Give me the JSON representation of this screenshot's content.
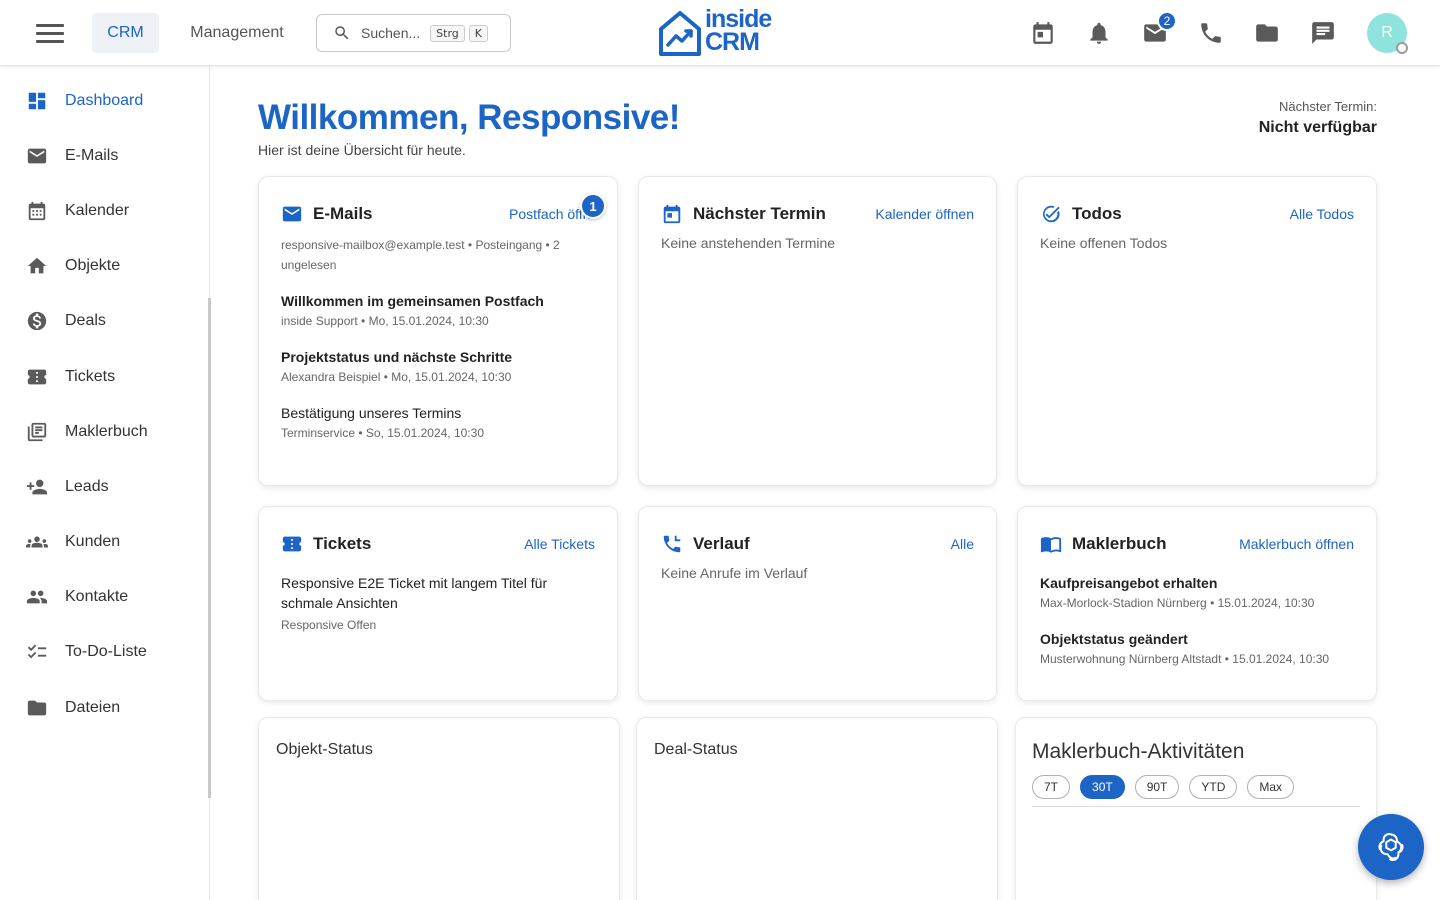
{
  "topbar": {
    "tabs": [
      "CRM",
      "Management"
    ],
    "search_placeholder": "Suchen...",
    "shortcut_keys": [
      "Strg",
      "K"
    ],
    "logo_line1": "inside",
    "logo_line2": "CRM",
    "mail_badge": "2",
    "avatar_initial": "R"
  },
  "sidebar": {
    "items": [
      {
        "label": "Dashboard",
        "icon": "dashboard-icon",
        "active": true
      },
      {
        "label": "E-Mails",
        "icon": "mail-icon"
      },
      {
        "label": "Kalender",
        "icon": "calendar-icon"
      },
      {
        "label": "Objekte",
        "icon": "home-icon"
      },
      {
        "label": "Deals",
        "icon": "dollar-icon"
      },
      {
        "label": "Tickets",
        "icon": "ticket-icon"
      },
      {
        "label": "Maklerbuch",
        "icon": "library-icon"
      },
      {
        "label": "Leads",
        "icon": "person-add-icon"
      },
      {
        "label": "Kunden",
        "icon": "groups-icon"
      },
      {
        "label": "Kontakte",
        "icon": "people-icon"
      },
      {
        "label": "To-Do-Liste",
        "icon": "checklist-icon"
      },
      {
        "label": "Dateien",
        "icon": "folder-icon"
      }
    ]
  },
  "header": {
    "welcome": "Willkommen, Responsive!",
    "subtitle": "Hier ist deine Übersicht für heute.",
    "next_label": "Nächster Termin:",
    "next_value": "Nicht verfügbar"
  },
  "cards": {
    "emails": {
      "title": "E-Mails",
      "link": "Postfach öffnen",
      "badge": "1",
      "summary": "responsive-mailbox@example.test • Posteingang • 2 ungelesen",
      "items": [
        {
          "subject": "Willkommen im gemeinsamen Postfach",
          "meta": "inside Support • Mo, 15.01.2024, 10:30"
        },
        {
          "subject": "Projektstatus und nächste Schritte",
          "meta": "Alexandra Beispiel • Mo, 15.01.2024, 10:30"
        },
        {
          "subject": "Bestätigung unseres Termins",
          "meta": "Terminservice • So, 15.01.2024, 10:30"
        }
      ]
    },
    "termin": {
      "title": "Nächster Termin",
      "link": "Kalender öffnen",
      "empty": "Keine anstehenden Termine"
    },
    "todos": {
      "title": "Todos",
      "link": "Alle Todos",
      "empty": "Keine offenen Todos"
    },
    "tickets": {
      "title": "Tickets",
      "link": "Alle Tickets",
      "items": [
        {
          "subject": "Responsive E2E Ticket mit langem Titel für schmale Ansichten",
          "meta": "Responsive Offen"
        }
      ]
    },
    "verlauf": {
      "title": "Verlauf",
      "link": "Alle",
      "empty": "Keine Anrufe im Verlauf"
    },
    "maklerbuch": {
      "title": "Maklerbuch",
      "link": "Maklerbuch öffnen",
      "items": [
        {
          "subject": "Kaufpreisangebot erhalten",
          "meta": "Max-Morlock-Stadion Nürnberg • 15.01.2024, 10:30"
        },
        {
          "subject": "Objektstatus geändert",
          "meta": "Musterwohnung Nürnberg Altstadt • 15.01.2024, 10:30"
        }
      ]
    },
    "objekt_status": {
      "title": "Objekt-Status"
    },
    "deal_status": {
      "title": "Deal-Status"
    },
    "makler_aktivitaeten": {
      "title": "Maklerbuch-Aktivitäten",
      "ranges": [
        "7T",
        "30T",
        "90T",
        "YTD",
        "Max"
      ],
      "active_range": "30T"
    }
  },
  "colors": {
    "accent": "#1c64c5",
    "avatar": "#8ee3dc"
  }
}
